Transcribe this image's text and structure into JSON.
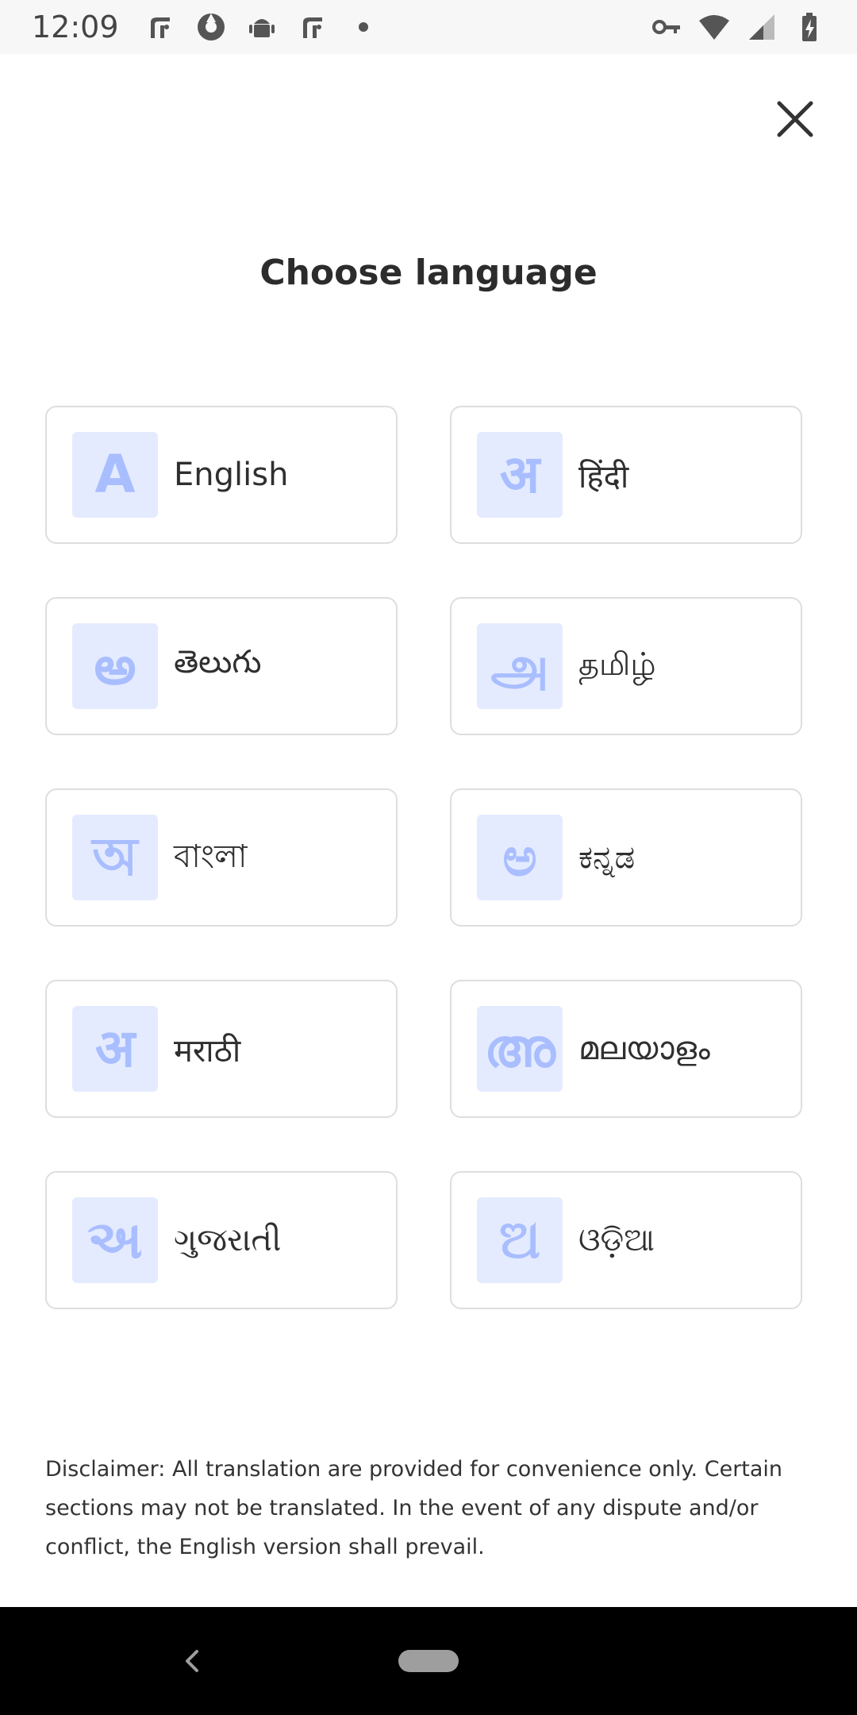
{
  "status_bar": {
    "time": "12:09",
    "left_icons": [
      "fi-app-icon",
      "shutter-app-icon",
      "android-icon",
      "fi-app-icon",
      "dot-icon"
    ],
    "right_icons": [
      "vpn-key-icon",
      "wifi-icon",
      "signal-icon",
      "battery-charging-icon"
    ]
  },
  "header": {
    "close_icon": "close-icon",
    "title": "Choose language"
  },
  "languages": [
    {
      "glyph": "A",
      "label": "English"
    },
    {
      "glyph": "अ",
      "label": "हिंदी"
    },
    {
      "glyph": "అ",
      "label": "తెలుగు"
    },
    {
      "glyph": "அ",
      "label": "தமிழ்"
    },
    {
      "glyph": "অ",
      "label": "বাংলা"
    },
    {
      "glyph": "ಅ",
      "label": "ಕನ್ನಡ"
    },
    {
      "glyph": "अ",
      "label": "मराठी"
    },
    {
      "glyph": "അ",
      "label": "മലയാളം"
    },
    {
      "glyph": "અ",
      "label": "ગુજરાતી"
    },
    {
      "glyph": "ଅ",
      "label": "ଓଡ଼ିଆ"
    }
  ],
  "disclaimer": "Disclaimer: All translation are provided for convenience only. Certain sections may not be translated. In the event of any dispute and/or conflict, the English version shall prevail.",
  "nav_bar": {
    "back_icon": "back-chevron-icon",
    "home_icon": "home-pill-icon"
  },
  "colors": {
    "glyph_bg": "#e5ebff",
    "glyph_fg": "#a9beff",
    "card_border": "#dedede",
    "text": "#2f2f2f"
  }
}
